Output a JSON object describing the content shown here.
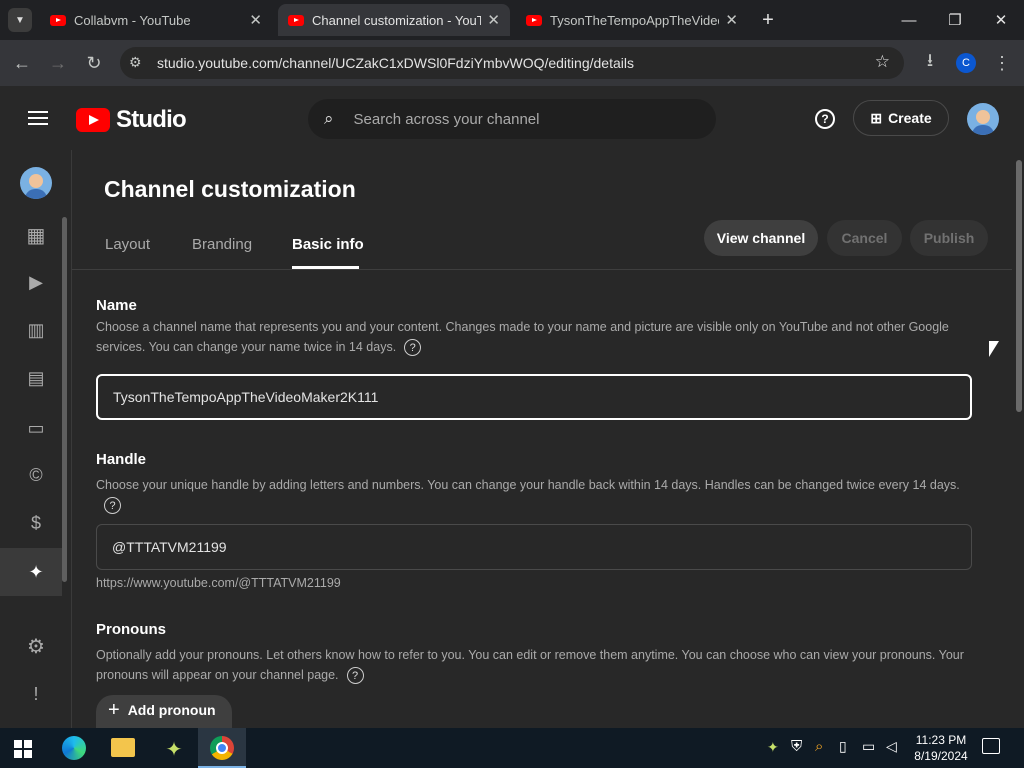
{
  "browser": {
    "tabs": [
      {
        "title": "Collabvm - YouTube",
        "active": false
      },
      {
        "title": "Channel customization - YouTube",
        "active": true
      },
      {
        "title": "TysonTheTempoAppTheVideoMaker",
        "active": false
      }
    ],
    "new_tab_icon": "plus-icon",
    "url": "studio.youtube.com/channel/UCZakC1xDWSl0FdziYmbvWOQ/editing/details",
    "profile_initial": "C"
  },
  "studio": {
    "logo_text": "Studio",
    "search_placeholder": "Search across your channel",
    "create_label": "Create"
  },
  "page": {
    "title": "Channel customization",
    "tabs": [
      {
        "label": "Layout",
        "active": false
      },
      {
        "label": "Branding",
        "active": false
      },
      {
        "label": "Basic info",
        "active": true
      }
    ],
    "view_channel_label": "View channel",
    "cancel_label": "Cancel",
    "publish_label": "Publish"
  },
  "name_section": {
    "title": "Name",
    "description": "Choose a channel name that represents you and your content. Changes made to your name and picture are visible only on YouTube and not other Google services. You can change your name twice in 14 days.",
    "value": "TysonTheTempoAppTheVideoMaker2K111"
  },
  "handle_section": {
    "title": "Handle",
    "description": "Choose your unique handle by adding letters and numbers. You can change your handle back within 14 days. Handles can be changed twice every 14 days.",
    "value": "@TTTATVM21199",
    "url": "https://www.youtube.com/@TTTATVM21199"
  },
  "pronouns_section": {
    "title": "Pronouns",
    "description": "Optionally add your pronouns. Let others know how to refer to you. You can edit or remove them anytime. You can choose who can view your pronouns. Your pronouns will appear on your channel page.",
    "add_label": "Add pronoun"
  },
  "taskbar": {
    "time": "11:23 PM",
    "date": "8/19/2024"
  },
  "colors": {
    "youtube_red": "#ff0000",
    "studio_bg": "#282828",
    "taskbar_bg": "#0f1a24"
  }
}
